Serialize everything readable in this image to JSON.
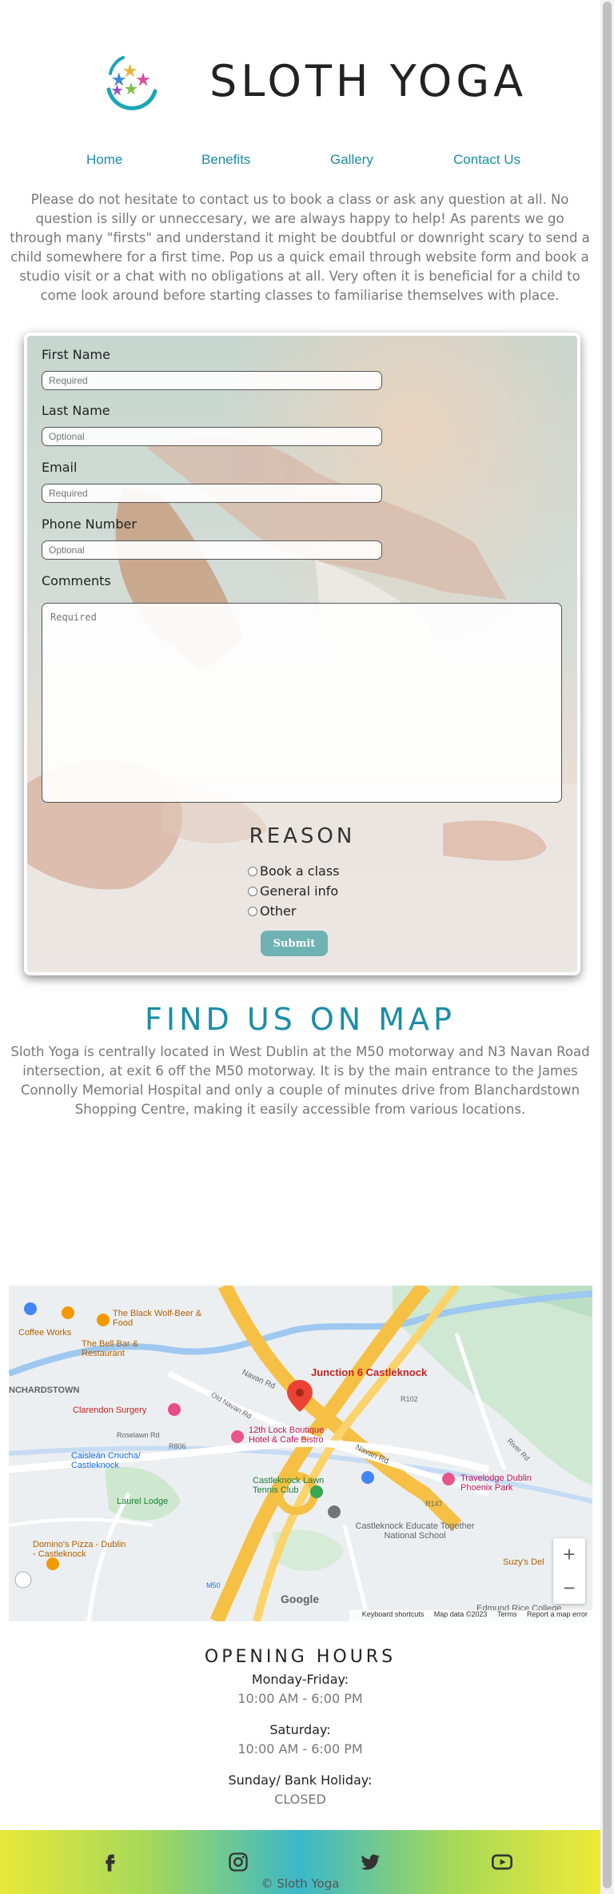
{
  "header": {
    "title": "SLOTH YOGA",
    "logo_icon": "colorful-stars-logo"
  },
  "nav": {
    "items": [
      "Home",
      "Benefits",
      "Gallery",
      "Contact Us"
    ]
  },
  "intro_text": "Please do not hesitate to contact us to book a class or ask any question at all. No question is silly or unneccesary, we are always happy to help! As parents we go through many \"firsts\" and understand it might be doubtful or downright scary to send a child somewhere for a first time. Pop us a quick email through website form and book a studio visit or a chat with no obligations at all. Very often it is beneficial for a child to come look around before starting classes to familiarise themselves with place.",
  "form": {
    "first_name_label": "First Name",
    "first_name_placeholder": "Required",
    "last_name_label": "Last Name",
    "last_name_placeholder": "Optional",
    "email_label": "Email",
    "email_placeholder": "Required",
    "phone_label": "Phone Number",
    "phone_placeholder": "Optional",
    "comments_label": "Comments",
    "comments_placeholder": "Required",
    "reason_title": "REASON",
    "reason_options": [
      "Book a class",
      "General info",
      "Other"
    ],
    "submit_label": "Submit"
  },
  "map_section": {
    "title": "FIND US ON MAP",
    "text": "Sloth Yoga is centrally located in West Dublin at the M50 motorway and N3 Navan Road intersection, at exit 6 off the M50 motorway. It is by the main entrance to the James Connolly Memorial Hospital and only a couple of minutes drive from Blanchardstown Shopping Centre, making it easily accessible from various locations."
  },
  "map": {
    "pin_label": "Junction 6 Castleknock",
    "places": {
      "costa": "Coffee Works",
      "black_wolf": "The Black Wolf-Beer & Food",
      "bell_bar": "The Bell Bar & Restaurant",
      "blanchardstown": "NCHARDSTOWN",
      "clarendon": "Clarendon Surgery",
      "boutique": "12th Lock Boutique Hotel & Cafe Bistro",
      "caislean": "Caisleán Cnucha/ Castleknock",
      "lawn_tennis": "Castleknock Lawn Tennis Club",
      "laurel": "Laurel Lodge",
      "educate": "Castleknock Educate Together National School",
      "travelodge": "Travelodge Dublin Phoenix Park",
      "dominos": "Domino's Pizza - Dublin - Castleknock",
      "suzys": "Suzy's Del",
      "edmund": "Edmund Rice College",
      "navan_rd_1": "Navan Rd",
      "navan_rd_2": "Navan Rd",
      "old_navan": "Old Navan Rd",
      "r102": "R102",
      "r147": "R147",
      "r806": "R806",
      "m50": "M50",
      "roselawn": "Roselawn Rd",
      "river_rd": "River Rd",
      "google": "Google"
    },
    "footer": [
      "Keyboard shortcuts",
      "Map data ©2023",
      "Terms",
      "Report a map error"
    ],
    "zoom_in": "+",
    "zoom_out": "−"
  },
  "hours": {
    "title": "OPENING HOURS",
    "rows": [
      {
        "day": "Monday-Friday:",
        "time": "10:00 AM - 6:00 PM"
      },
      {
        "day": "Saturday:",
        "time": "10:00 AM - 6:00 PM"
      },
      {
        "day": "Sunday/ Bank Holiday:",
        "time": "CLOSED"
      }
    ]
  },
  "footer": {
    "icons": [
      "facebook-icon",
      "instagram-icon",
      "twitter-icon",
      "youtube-icon"
    ],
    "copyright": "© Sloth Yoga"
  },
  "colors": {
    "accent": "#1a8da7",
    "submit": "#6fb2b3",
    "muted_text": "#777777"
  }
}
